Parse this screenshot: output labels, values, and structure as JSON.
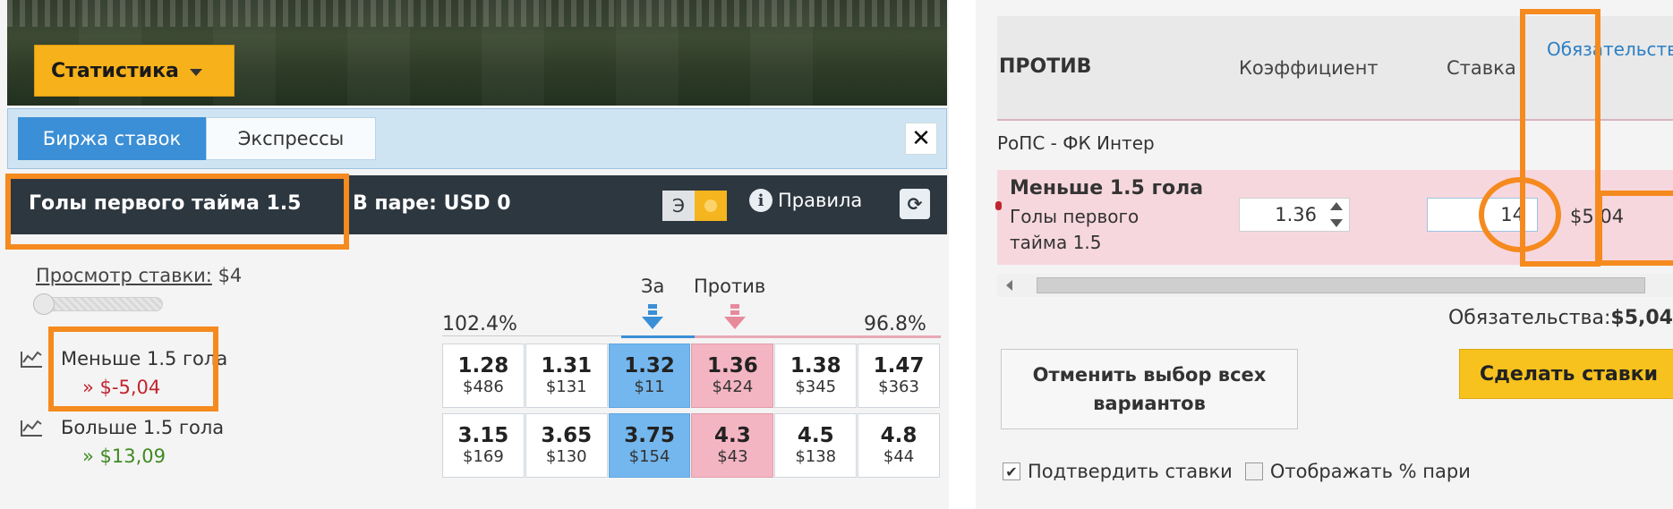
{
  "left": {
    "stats_button": {
      "label": "Статистика"
    },
    "tabs": [
      {
        "label": "Биржа ставок",
        "active": true
      },
      {
        "label": "Экспрессы",
        "active": false
      }
    ],
    "close_label": "✕",
    "market": {
      "title": "Голы первого тайма 1.5",
      "pair_text": "В паре: USD 0",
      "e_label": "Э",
      "rules_label": "Правила"
    },
    "view_bet": {
      "label": "Просмотр ставки:",
      "value": "$4"
    },
    "book_back": "102.4%",
    "book_lay": "96.8%",
    "header_for": "За",
    "header_against": "Против",
    "runners": [
      {
        "name": "Меньше 1.5 гола",
        "pnl": "» $-5,04",
        "odds": [
          {
            "odds": "1.28",
            "amount": "$486",
            "type": "plain"
          },
          {
            "odds": "1.31",
            "amount": "$131",
            "type": "plain"
          },
          {
            "odds": "1.32",
            "amount": "$11",
            "type": "back"
          },
          {
            "odds": "1.36",
            "amount": "$424",
            "type": "lay"
          },
          {
            "odds": "1.38",
            "amount": "$345",
            "type": "plain"
          },
          {
            "odds": "1.47",
            "amount": "$363",
            "type": "plain"
          }
        ]
      },
      {
        "name": "Больше 1.5 гола",
        "pnl": "» $13,09",
        "odds": [
          {
            "odds": "3.15",
            "amount": "$169",
            "type": "plain"
          },
          {
            "odds": "3.65",
            "amount": "$130",
            "type": "plain"
          },
          {
            "odds": "3.75",
            "amount": "$154",
            "type": "back"
          },
          {
            "odds": "4.3",
            "amount": "$43",
            "type": "lay"
          },
          {
            "odds": "4.5",
            "amount": "$138",
            "type": "plain"
          },
          {
            "odds": "4.8",
            "amount": "$44",
            "type": "plain"
          }
        ]
      }
    ]
  },
  "right": {
    "columns": {
      "against": "ПРОТИВ",
      "coef": "Коэффициент",
      "stake": "Ставка",
      "liability": "Обязательства"
    },
    "event": "РоПС - ФК Интер",
    "bet": {
      "selection": "Меньше 1.5 гола",
      "market": "Голы первого тайма 1.5",
      "odds": "1.36",
      "stake": "14",
      "liability": "$5,04"
    },
    "liability_total_label": "Обязательства:",
    "liability_total_value": "$5,04",
    "cancel_all": "Отменить выбор всех вариантов",
    "place_bets": "Сделать ставки",
    "confirm_bets": "Подтвердить ставки",
    "show_pct": "Отображать % пари"
  },
  "colors": {
    "annotation": "#f58a1f",
    "back": "#74b7ee",
    "lay": "#f4b5c2",
    "header_dark": "#2d3740",
    "stats_button": "#f7b21b",
    "neg": "#c0252e",
    "pos": "#3f8a21"
  }
}
